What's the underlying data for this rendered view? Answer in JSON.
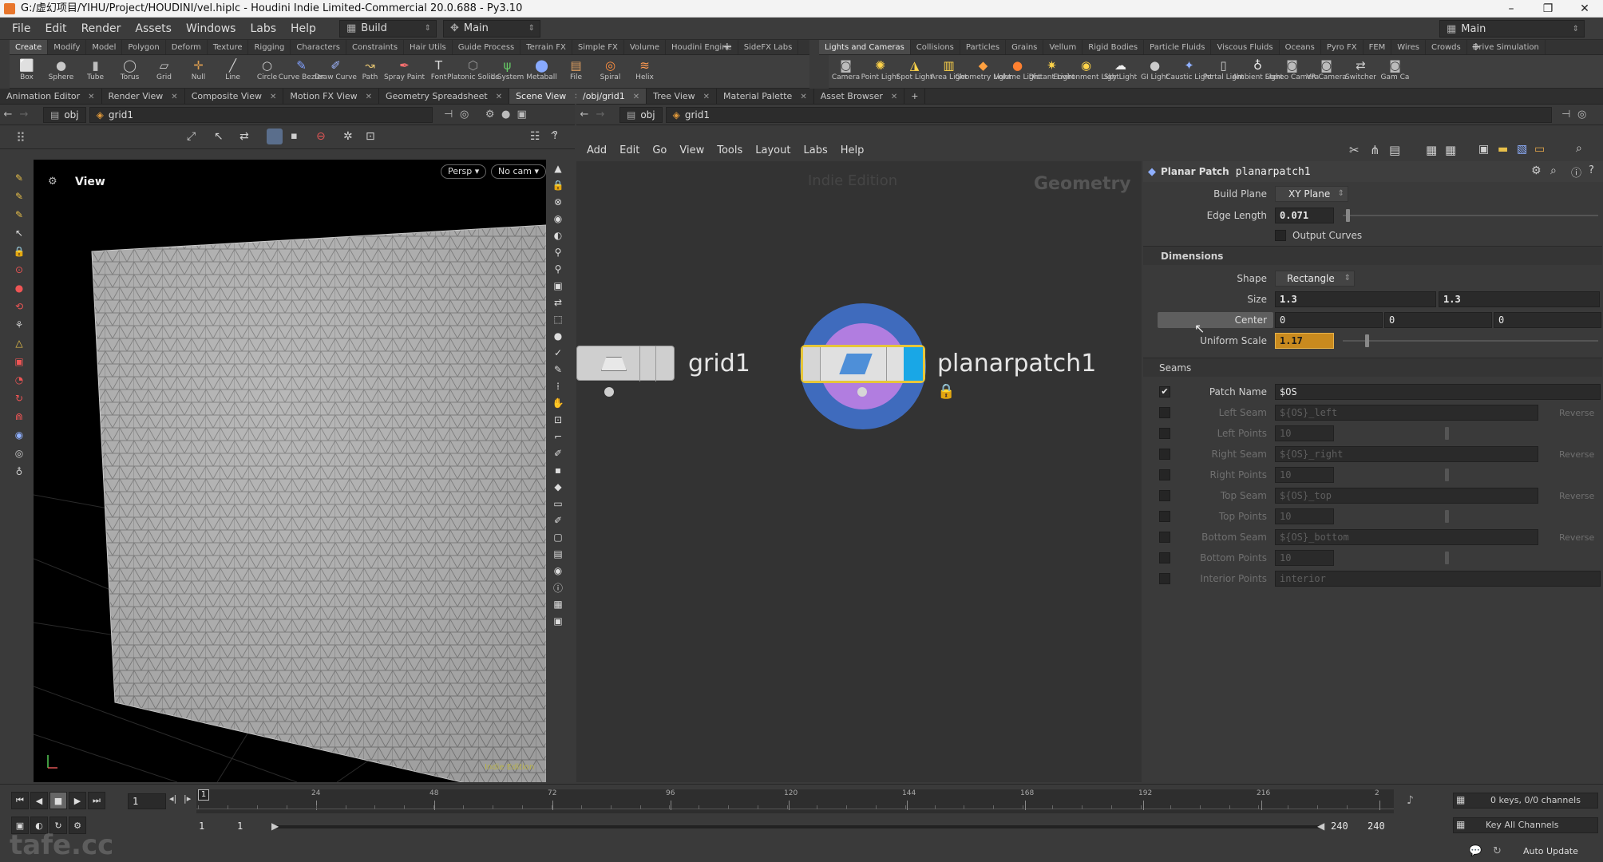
{
  "window": {
    "title": "G:/虚幻项目/YIHU/Project/HOUDINI/vel.hiplc - Houdini Indie Limited-Commercial 20.0.688 - Py3.10",
    "min": "–",
    "max": "❐",
    "close": "✕"
  },
  "menus": [
    "File",
    "Edit",
    "Render",
    "Assets",
    "Windows",
    "Labs",
    "Help"
  ],
  "desktop": {
    "left": "Build",
    "mid": "Main",
    "right": "Main"
  },
  "shelf_tabs_left": [
    "Create",
    "Modify",
    "Model",
    "Polygon",
    "Deform",
    "Texture",
    "Rigging",
    "Characters",
    "Constraints",
    "Hair Utils",
    "Guide Process",
    "Terrain FX",
    "Simple FX",
    "Volume",
    "Houdini Engine",
    "SideFX Labs"
  ],
  "shelf_tabs_right": [
    "Lights and Cameras",
    "Collisions",
    "Particles",
    "Grains",
    "Vellum",
    "Rigid Bodies",
    "Particle Fluids",
    "Viscous Fluids",
    "Oceans",
    "Pyro FX",
    "FEM",
    "Wires",
    "Crowds",
    "Drive Simulation"
  ],
  "tools_left": [
    {
      "label": "Box",
      "icon": "⬜",
      "color": "#bfbfbf"
    },
    {
      "label": "Sphere",
      "icon": "●",
      "color": "#c8c8c8"
    },
    {
      "label": "Tube",
      "icon": "▮",
      "color": "#bdbdbd"
    },
    {
      "label": "Torus",
      "icon": "◯",
      "color": "#c8c8c8"
    },
    {
      "label": "Grid",
      "icon": "▱",
      "color": "#d0d0d0"
    },
    {
      "label": "Null",
      "icon": "✛",
      "color": "#e0a050"
    },
    {
      "label": "Line",
      "icon": "╱",
      "color": "#d0d0d0"
    },
    {
      "label": "Circle",
      "icon": "○",
      "color": "#d0d0d0"
    },
    {
      "label": "Curve Bezier",
      "icon": "✎",
      "color": "#80a0ff"
    },
    {
      "label": "Draw Curve",
      "icon": "✐",
      "color": "#9fb6ff"
    },
    {
      "label": "Path",
      "icon": "↝",
      "color": "#e0c070"
    },
    {
      "label": "Spray Paint",
      "icon": "✒",
      "color": "#ff7070"
    },
    {
      "label": "Font",
      "icon": "T",
      "color": "#dddddd"
    },
    {
      "label": "Platonic Solids",
      "icon": "⬡",
      "color": "#9a9a9a"
    },
    {
      "label": "L-System",
      "icon": "ψ",
      "color": "#66cc66"
    },
    {
      "label": "Metaball",
      "icon": "⬤",
      "color": "#88aaff"
    },
    {
      "label": "File",
      "icon": "▤",
      "color": "#e0a060"
    },
    {
      "label": "Spiral",
      "icon": "◎",
      "color": "#ff9040"
    },
    {
      "label": "Helix",
      "icon": "≋",
      "color": "#ff9a50"
    }
  ],
  "tools_right": [
    {
      "label": "Camera",
      "icon": "◙",
      "color": "#bbbbbb"
    },
    {
      "label": "Point Light",
      "icon": "✺",
      "color": "#ffd44a"
    },
    {
      "label": "Spot Light",
      "icon": "◮",
      "color": "#ffd44a"
    },
    {
      "label": "Area Light",
      "icon": "▥",
      "color": "#ffd44a"
    },
    {
      "label": "Geometry Light",
      "icon": "◆",
      "color": "#ffa040"
    },
    {
      "label": "Volume Light",
      "icon": "●",
      "color": "#ff8030"
    },
    {
      "label": "Distant Light",
      "icon": "✷",
      "color": "#ffd44a"
    },
    {
      "label": "Environment Light",
      "icon": "◉",
      "color": "#ffd44a"
    },
    {
      "label": "Sky Light",
      "icon": "☁",
      "color": "#eeeeee"
    },
    {
      "label": "GI Light",
      "icon": "●",
      "color": "#cccccc"
    },
    {
      "label": "Caustic Light",
      "icon": "✦",
      "color": "#8fb0ff"
    },
    {
      "label": "Portal Light",
      "icon": "▯",
      "color": "#cccccc"
    },
    {
      "label": "Ambient Light",
      "icon": "♁",
      "color": "#eeeeee"
    },
    {
      "label": "Stereo Camera",
      "icon": "◙",
      "color": "#bbbbbb"
    },
    {
      "label": "VR Camera",
      "icon": "◙",
      "color": "#bbbbbb"
    },
    {
      "label": "Switcher",
      "icon": "⇄",
      "color": "#cccccc"
    },
    {
      "label": "Gam Ca",
      "icon": "◙",
      "color": "#bbbbbb"
    }
  ],
  "left_panes": [
    "Animation Editor",
    "Render View",
    "Composite View",
    "Motion FX View",
    "Geometry Spreadsheet",
    "Scene View"
  ],
  "right_panes": [
    "/obj/grid1",
    "Tree View",
    "Material Palette",
    "Asset Browser"
  ],
  "viewer": {
    "path_root": "obj",
    "path_node": "grid1",
    "label": "View",
    "persp": "Persp",
    "cam": "No cam",
    "watermark": "Indie Edition"
  },
  "network": {
    "path_root": "obj",
    "path_node": "grid1",
    "menu": [
      "Add",
      "Edit",
      "Go",
      "View",
      "Tools",
      "Layout",
      "Labs",
      "Help"
    ],
    "watermark": "Indie Edition",
    "context": "Geometry",
    "node1": "grid1",
    "node2": "planarpatch1"
  },
  "params": {
    "type": "Planar Patch",
    "name": "planarpatch1",
    "build_plane_label": "Build Plane",
    "build_plane": "XY Plane",
    "edge_length_label": "Edge Length",
    "edge_length": "0.071",
    "output_curves": "Output Curves",
    "dimensions": "Dimensions",
    "shape_label": "Shape",
    "shape": "Rectangle",
    "size_label": "Size",
    "size_x": "1.3",
    "size_y": "1.3",
    "center_label": "Center",
    "center": [
      "0",
      "0",
      "0"
    ],
    "uscale_label": "Uniform Scale",
    "uscale": "1.17",
    "seams": "Seams",
    "patch_name_label": "Patch Name",
    "patch_name": "$OS",
    "rows": [
      {
        "label": "Left Seam",
        "value": "${OS}_left",
        "rev": "Reverse"
      },
      {
        "label": "Left Points",
        "value": "10"
      },
      {
        "label": "Right Seam",
        "value": "${OS}_right",
        "rev": "Reverse"
      },
      {
        "label": "Right Points",
        "value": "10"
      },
      {
        "label": "Top Seam",
        "value": "${OS}_top",
        "rev": "Reverse"
      },
      {
        "label": "Top Points",
        "value": "10"
      },
      {
        "label": "Bottom Seam",
        "value": "${OS}_bottom",
        "rev": "Reverse"
      },
      {
        "label": "Bottom Points",
        "value": "10"
      },
      {
        "label": "Interior Points",
        "value": "interior"
      }
    ]
  },
  "timeline": {
    "frame": "1",
    "ticks": [
      "24",
      "48",
      "72",
      "96",
      "120",
      "144",
      "168",
      "192",
      "216",
      "2"
    ],
    "start": "1",
    "start2": "1",
    "end": "240",
    "end2": "240",
    "keys": "0 keys, 0/0 channels",
    "key_all": "Key All Channels",
    "auto_update": "Auto Update",
    "cursor_frame": "1"
  },
  "watermark_logo": "tafe.cc"
}
